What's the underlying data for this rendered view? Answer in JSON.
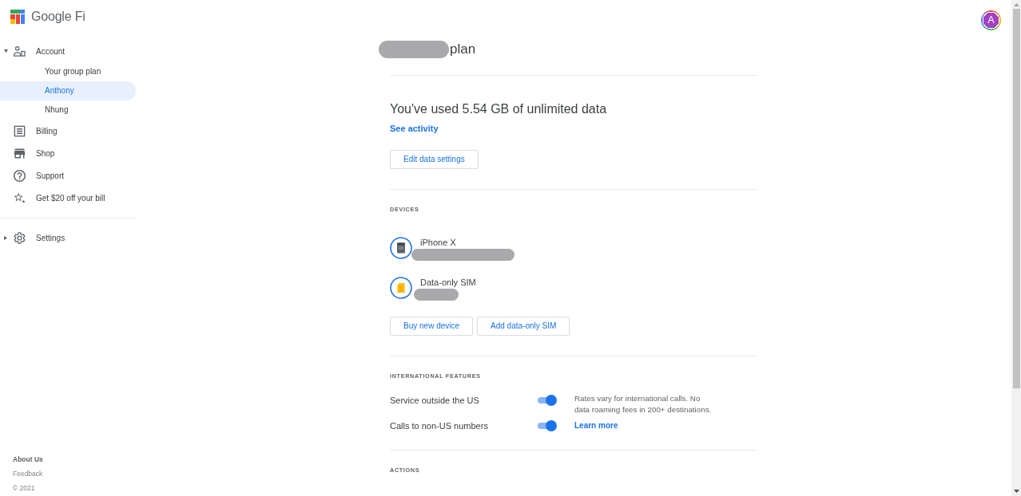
{
  "header": {
    "avatar": {
      "initial": "A"
    }
  },
  "sidebar": {
    "logo": {
      "text": "Google Fi"
    },
    "sections": [
      {
        "items": [
          {
            "label": "Account",
            "kind": "account",
            "selected": false,
            "expanded": true,
            "children": [
              {
                "label": "Your group plan",
                "selected": false
              },
              {
                "label": "Anthony",
                "selected": true
              },
              {
                "label": "Nhung",
                "selected": false
              }
            ]
          },
          {
            "label": "Billing",
            "kind": "billing",
            "selected": false
          },
          {
            "label": "Shop",
            "kind": "shop",
            "selected": false
          },
          {
            "label": "Support",
            "kind": "support",
            "selected": false
          },
          {
            "label": "Get $20 off your bill",
            "kind": "referral",
            "selected": false
          }
        ]
      },
      {
        "items": [
          {
            "label": "Settings",
            "kind": "settings",
            "selected": false,
            "expanded": false
          }
        ]
      }
    ],
    "footer": {
      "links": [
        "About Us",
        "Feedback"
      ],
      "copyright": "© 2021"
    }
  },
  "plan": {
    "title": "plan",
    "title_redacted": true
  },
  "usage": {
    "heading": "You've used 5.54 GB of unlimited data",
    "link": "See activity",
    "button": "Edit data settings"
  },
  "devices": {
    "heading": "DEVICES",
    "items": [
      {
        "name": "iPhone X",
        "kind": "phone",
        "detail_redacted": true
      },
      {
        "name": "Data-only SIM",
        "kind": "sim",
        "detail_redacted": true
      }
    ],
    "buttons": [
      "Buy new device",
      "Add data-only SIM"
    ]
  },
  "international": {
    "heading": "INTERNATIONAL FEATURES",
    "settings": [
      {
        "label": "Service outside the US",
        "on": true
      },
      {
        "label": "Calls to non-US numbers",
        "on": true
      }
    ],
    "note": "Rates vary for international calls. No data roaming fees in 200+ destinations.",
    "link": "Learn more"
  },
  "actions": {
    "heading": "ACTIONS"
  }
}
